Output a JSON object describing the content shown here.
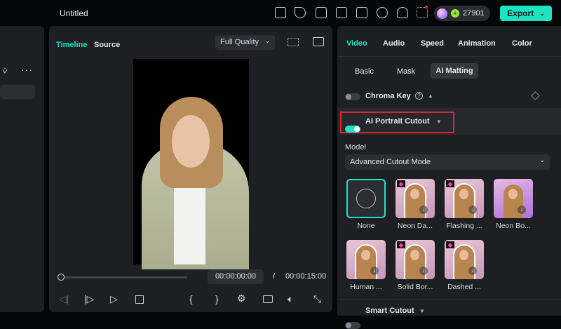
{
  "header": {
    "title": "Untitled",
    "credits": "27901",
    "export_label": "Export",
    "icons": [
      "gift-icon",
      "send-icon",
      "schedule-icon",
      "layout-icon",
      "save-icon",
      "cloud-upload-icon",
      "headset-icon",
      "apps-icon"
    ]
  },
  "center": {
    "tabs": [
      "Timeline",
      "Source"
    ],
    "quality": "Full Quality",
    "current_time": "00:00:00:00",
    "separator": "/",
    "total_time": "00:00:15:00"
  },
  "right": {
    "tabs": [
      "Video",
      "Audio",
      "Speed",
      "Animation",
      "Color"
    ],
    "subtabs": [
      "Basic",
      "Mask",
      "AI Matting"
    ],
    "chroma_key": "Chroma Key",
    "ai_portrait": "AI Portrait Cutout",
    "model_label": "Model",
    "model_value": "Advanced Cutout Mode",
    "effects": [
      "None",
      "Neon Da...",
      "Flashing ...",
      "Neon Bo...",
      "Human ...",
      "Solid Bor...",
      "Dashed ..."
    ],
    "smart_cutout": "Smart Cutout"
  },
  "colors": {
    "accent": "#1ee3c0",
    "highlight": "#e0252c"
  }
}
